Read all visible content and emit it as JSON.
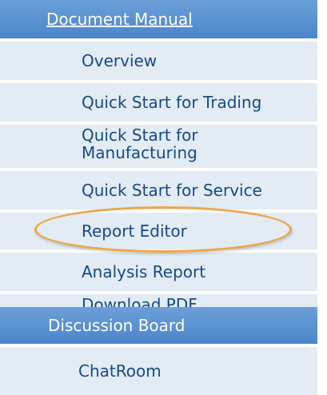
{
  "menu": {
    "section_doc": {
      "label": "Document Manual"
    },
    "doc_items": [
      {
        "label": "Overview"
      },
      {
        "label": "Quick Start for Trading"
      },
      {
        "label": "Quick Start for\nManufacturing"
      },
      {
        "label": "Quick Start for Service"
      },
      {
        "label": "Report Editor"
      },
      {
        "label": "Analysis Report"
      },
      {
        "label": "Download PDF"
      }
    ],
    "section_discussion": {
      "label": "Discussion Board"
    },
    "discussion_items": [
      {
        "label": "ChatRoom"
      }
    ]
  },
  "colors": {
    "header_bg": "#5b92d2",
    "item_bg": "#e3ecf4",
    "item_text": "#13498c",
    "highlight": "#f0a546"
  }
}
